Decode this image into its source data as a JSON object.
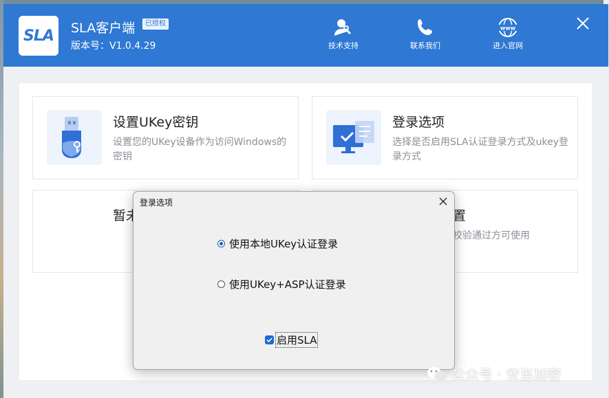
{
  "app": {
    "name": "SLA客户端",
    "badge": "已授权",
    "version": "版本号：V1.0.4.29",
    "logo_text": "SLA"
  },
  "toolbar": {
    "support_label": "技术支持",
    "contact_label": "联系我们",
    "website_label": "进入官网"
  },
  "cards": [
    {
      "title": "设置UKey密钥",
      "desc": "设置您的UKey设备作为访问Windows的密钥"
    },
    {
      "title": "登录选项",
      "desc": "选择是否启用SLA认证登录方式及ukey登录方式"
    },
    {
      "title_partial": "暂未",
      "desc": ""
    },
    {
      "title_partial": "置",
      "desc_partial": "校验通过方可使用"
    }
  ],
  "dialog": {
    "title": "登录选项",
    "option1": "使用本地UKey认证登录",
    "option2": "使用UKey+ASP认证登录",
    "option1_selected": true,
    "enable_sla_label": "启用SLA",
    "enable_sla_checked": true
  },
  "watermark": "公众号 · 安当加密",
  "colors": {
    "titlebar": "#2f78d4",
    "accent": "#1a6bd0"
  }
}
